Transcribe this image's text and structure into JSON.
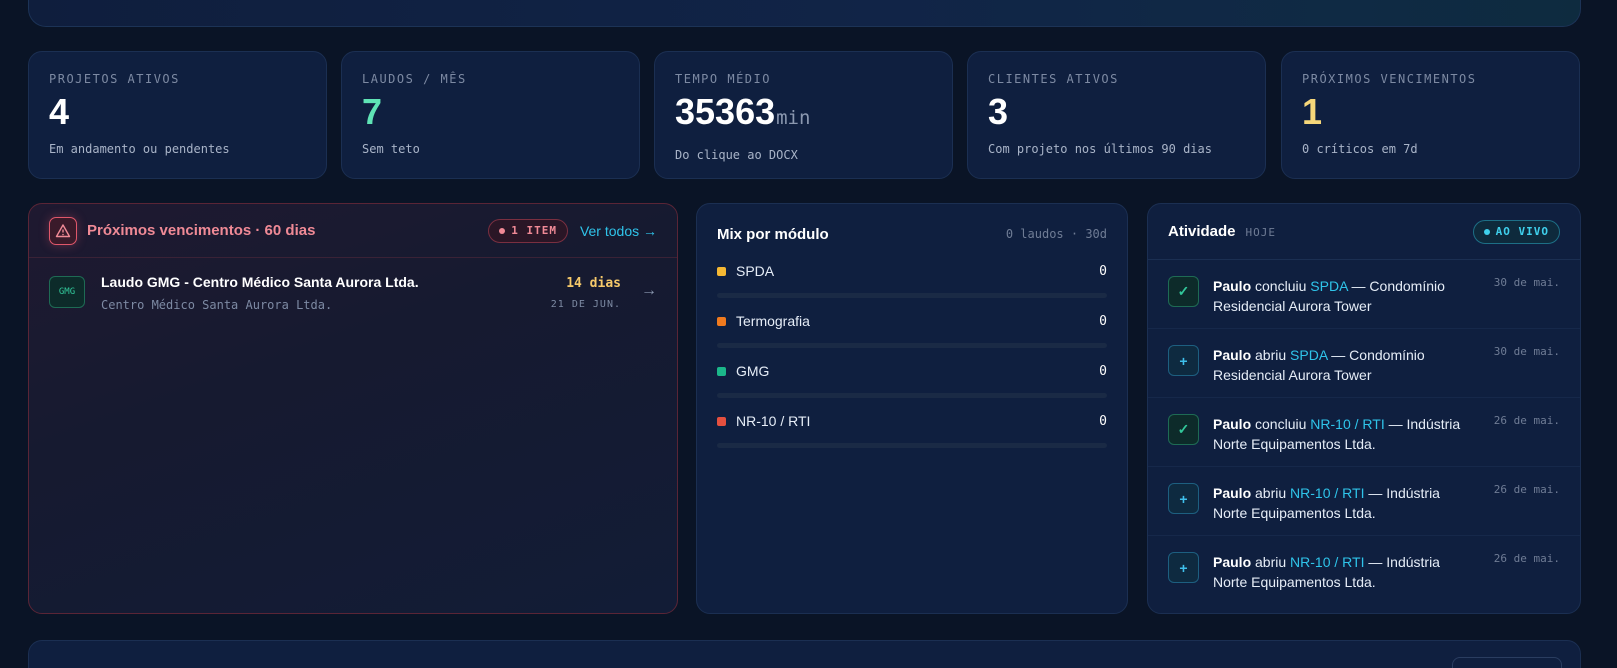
{
  "kpis": [
    {
      "label": "PROJETOS ATIVOS",
      "value": "4",
      "unit": "",
      "sub": "Em andamento ou pendentes",
      "color": "#ffffff"
    },
    {
      "label": "LAUDOS / MÊS",
      "value": "7",
      "unit": "",
      "sub": "Sem teto",
      "color": "#5fe3b5"
    },
    {
      "label": "TEMPO MÉDIO",
      "value": "35363",
      "unit": "min",
      "sub": "Do clique ao DOCX",
      "color": "#ffffff"
    },
    {
      "label": "CLIENTES ATIVOS",
      "value": "3",
      "unit": "",
      "sub": "Com projeto nos últimos 90 dias",
      "color": "#ffffff"
    },
    {
      "label": "PRÓXIMOS VENCIMENTOS",
      "value": "1",
      "unit": "",
      "sub": "0 críticos em 7d",
      "color": "#f6d77a"
    }
  ],
  "due": {
    "title": "Próximos vencimentos · 60 dias",
    "badge": "1 ITEM",
    "link": "Ver todos →",
    "items": [
      {
        "tag": "GMG",
        "name": "Laudo GMG - Centro Médico Santa Aurora Ltda.",
        "client": "Centro Médico Santa Aurora Ltda.",
        "days": "14 dias",
        "date": "21 DE JUN."
      }
    ]
  },
  "mix": {
    "title": "Mix por módulo",
    "meta": "0 laudos · 30d",
    "rows": [
      {
        "name": "SPDA",
        "value": "0",
        "color": "#f5b833"
      },
      {
        "name": "Termografia",
        "value": "0",
        "color": "#f07a1e"
      },
      {
        "name": "GMG",
        "value": "0",
        "color": "#1bb78a"
      },
      {
        "name": "NR-10 / RTI",
        "value": "0",
        "color": "#e5503f"
      }
    ]
  },
  "activity": {
    "title": "Atividade",
    "sub": "HOJE",
    "live": "AO VIVO",
    "items": [
      {
        "kind": "done",
        "icon": "✓",
        "user": "Paulo",
        "verb": " concluiu ",
        "module": "SPDA",
        "rest": " — Condomínio Residencial Aurora Tower",
        "date": "30 de mai."
      },
      {
        "kind": "add",
        "icon": "+",
        "user": "Paulo",
        "verb": " abriu ",
        "module": "SPDA",
        "rest": " — Condomínio Residencial Aurora Tower",
        "date": "30 de mai."
      },
      {
        "kind": "done",
        "icon": "✓",
        "user": "Paulo",
        "verb": " concluiu ",
        "module": "NR-10 / RTI",
        "rest": " — Indústria Norte Equipamentos Ltda.",
        "date": "26 de mai."
      },
      {
        "kind": "add",
        "icon": "+",
        "user": "Paulo",
        "verb": " abriu ",
        "module": "NR-10 / RTI",
        "rest": " — Indústria Norte Equipamentos Ltda.",
        "date": "26 de mai."
      },
      {
        "kind": "add",
        "icon": "+",
        "user": "Paulo",
        "verb": " abriu ",
        "module": "NR-10 / RTI",
        "rest": " — Indústria Norte Equipamentos Ltda.",
        "date": "26 de mai."
      }
    ]
  }
}
